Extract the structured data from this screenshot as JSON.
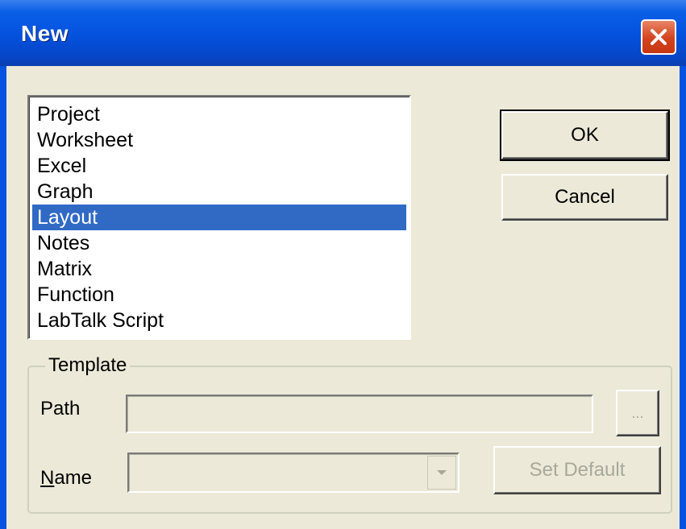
{
  "window": {
    "title": "New",
    "accent": "#0553e0"
  },
  "list": {
    "items": [
      "Project",
      "Worksheet",
      "Excel",
      "Graph",
      "Layout",
      "Notes",
      "Matrix",
      "Function",
      "LabTalk Script"
    ],
    "selected_index": 4,
    "selected_color": "#316ac5"
  },
  "buttons": {
    "ok_label": "OK",
    "cancel_label": "Cancel",
    "browse_label": "...",
    "set_default_label": "Set Default"
  },
  "template": {
    "group_label": "Template",
    "path_label": "Path",
    "path_value": "",
    "name_label_first": "N",
    "name_label_rest": "ame",
    "name_value": ""
  },
  "icons": {
    "close": "close-icon",
    "combo_arrow": "chevron-down-icon"
  }
}
